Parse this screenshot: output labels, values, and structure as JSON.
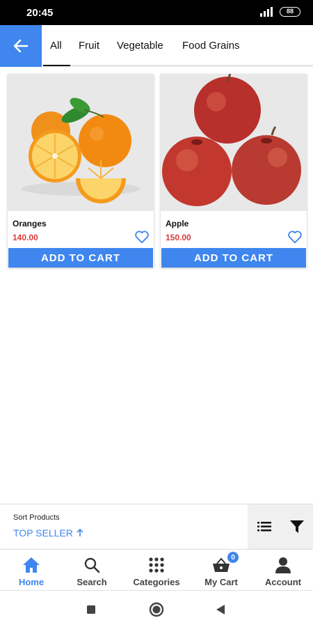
{
  "status_bar": {
    "time": "20:45",
    "battery": "88"
  },
  "tabs": [
    {
      "label": "All",
      "active": true
    },
    {
      "label": "Fruit",
      "active": false
    },
    {
      "label": "Vegetable",
      "active": false
    },
    {
      "label": "Food Grains",
      "active": false
    }
  ],
  "products": [
    {
      "name": "Oranges",
      "price": "140.00",
      "button": "ADD TO CART",
      "image_icon": "oranges-image"
    },
    {
      "name": "Apple",
      "price": "150.00",
      "button": "ADD TO CART",
      "image_icon": "apples-image"
    }
  ],
  "sort": {
    "label": "Sort Products",
    "value": "TOP SELLER"
  },
  "bottom_nav": [
    {
      "label": "Home",
      "icon": "home-icon",
      "active": true
    },
    {
      "label": "Search",
      "icon": "search-icon",
      "active": false
    },
    {
      "label": "Categories",
      "icon": "grid-icon",
      "active": false
    },
    {
      "label": "My Cart",
      "icon": "basket-icon",
      "active": false,
      "badge": "0"
    },
    {
      "label": "Account",
      "icon": "person-icon",
      "active": false
    }
  ],
  "colors": {
    "accent": "#3f86ee",
    "price": "#d93b3b",
    "image_bg": "#e8e8e8"
  }
}
